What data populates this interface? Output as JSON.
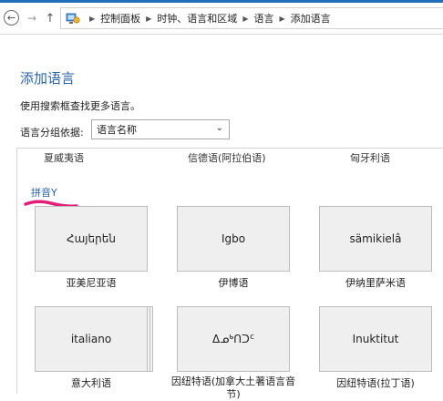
{
  "breadcrumbs": [
    "控制面板",
    "时钟、语言和区域",
    "语言",
    "添加语言"
  ],
  "page": {
    "title": "添加语言",
    "description": "使用搜索框查找更多语言。",
    "group_by_label": "语言分组依据:",
    "group_by_value": "语言名称"
  },
  "previous_row": [
    "夏威夷语",
    "信德语(阿拉伯语)",
    "匈牙利语"
  ],
  "group_header": "拼音Y",
  "languages": [
    {
      "native": "Հայերեն",
      "name": "亚美尼亚语"
    },
    {
      "native": "Igbo",
      "name": "伊博语"
    },
    {
      "native": "sämikielâ",
      "name": "伊纳里萨米语"
    },
    {
      "native": "italiano",
      "name": "意大利语"
    },
    {
      "native": "ᐃᓄᒃᑎᑐᑦ",
      "name": "因纽特语(加拿大土著语言音节)"
    },
    {
      "native": "Inuktitut",
      "name": "因纽特语(拉丁语)"
    }
  ],
  "colors": {
    "link": "#2a63a8",
    "highlight": "#e0207a",
    "accent": "#1e6fb8"
  }
}
